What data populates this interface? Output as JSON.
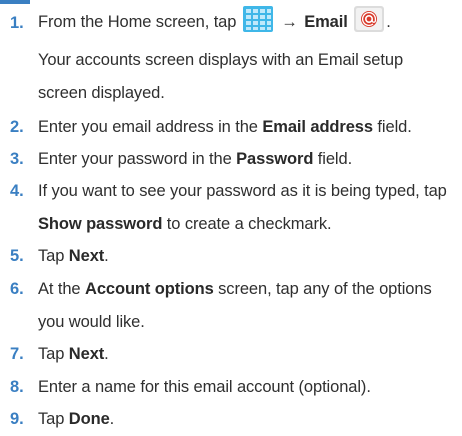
{
  "steps": [
    {
      "number": "1.",
      "parts": [
        "From the Home screen, tap",
        "→",
        "Email"
      ],
      "note": "Your accounts screen displays with an Email setup screen displayed.",
      "icons": [
        "apps-grid-icon",
        "email-icon"
      ]
    },
    {
      "number": "2.",
      "pre": "Enter you email address in the ",
      "bold": "Email address",
      "post": " field."
    },
    {
      "number": "3.",
      "pre": "Enter your password in the ",
      "bold": "Password",
      "post": " field."
    },
    {
      "number": "4.",
      "pre": "If you want to see your password as it is being typed, tap ",
      "bold": "Show password",
      "post": " to create a checkmark."
    },
    {
      "number": "5.",
      "pre": "Tap ",
      "bold": "Next",
      "post": "."
    },
    {
      "number": "6.",
      "pre": "At the ",
      "bold": "Account options",
      "post": " screen, tap any of the options you would like."
    },
    {
      "number": "7.",
      "pre": "Tap ",
      "bold": "Next",
      "post": "."
    },
    {
      "number": "8.",
      "text": "Enter a name for this email account (optional)."
    },
    {
      "number": "9.",
      "pre": "Tap ",
      "bold": "Done",
      "post": "."
    }
  ],
  "colors": {
    "accent": "#3a7fc2",
    "text": "#2f2f2f",
    "email_icon_red": "#d93a2b"
  }
}
